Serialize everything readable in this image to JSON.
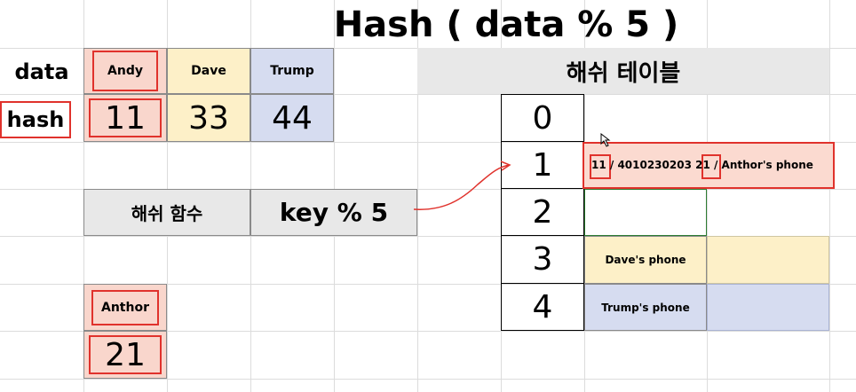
{
  "title": "Hash ( data % 5 )",
  "row_labels": {
    "data": "data",
    "hash": "hash"
  },
  "data_cells": [
    {
      "name": "Andy",
      "hash": "11",
      "color": "#f9d6cc"
    },
    {
      "name": "Dave",
      "hash": "33",
      "color": "#fdf0c8"
    },
    {
      "name": "Trump",
      "hash": "44",
      "color": "#d6dcf0"
    }
  ],
  "hash_function": {
    "label": "해쉬 함수",
    "formula": "key % 5"
  },
  "extra": {
    "name": "Anthor",
    "hash": "21"
  },
  "hash_table": {
    "title": "해쉬 테이블",
    "indices": [
      "0",
      "1",
      "2",
      "3",
      "4"
    ],
    "row1_text": "11 / 4010230203 21 / Anthor's phone",
    "row3_value": "Dave's phone",
    "row4_value": "Trump's phone"
  },
  "colors": {
    "highlight_red": "#e0322c",
    "header_gray": "#e8e8e8",
    "andy_bg": "#f9d6cc",
    "dave_bg": "#fdf0c8",
    "trump_bg": "#d6dcf0",
    "row1_bg": "#fbdad0"
  }
}
